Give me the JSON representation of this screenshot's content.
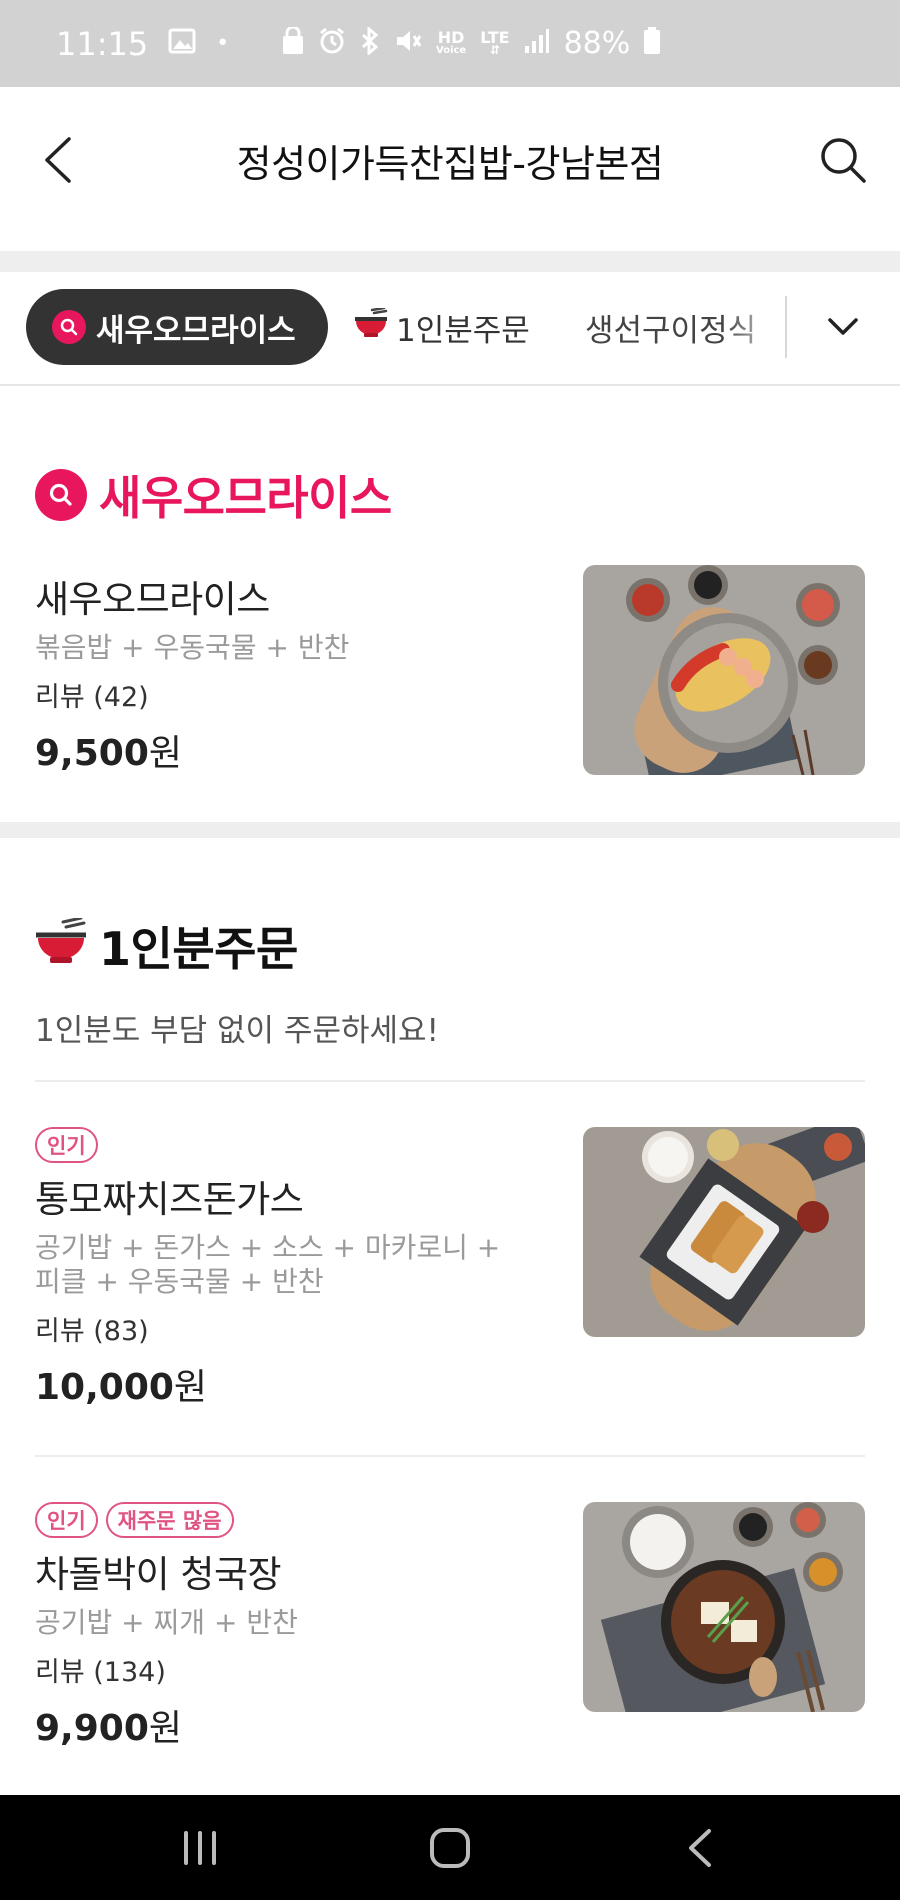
{
  "status_bar": {
    "time": "11:15",
    "dot": "•",
    "network_hd": "HD",
    "network_voice": "Voice",
    "network_lte": "LTE",
    "battery": "88%"
  },
  "header": {
    "title": "정성이가득찬집밥-강남본점",
    "back_icon": "chevron-left-icon",
    "search_icon": "search-icon"
  },
  "tabs": [
    {
      "label": "새우오므라이스",
      "icon": "search-icon",
      "active": true
    },
    {
      "label": "1인분주문",
      "icon": "bowl-icon",
      "active": false
    },
    {
      "label": "생선구이정식",
      "icon": "",
      "active": false
    }
  ],
  "sections": [
    {
      "title": "새우오므라이스",
      "icon": "search-icon",
      "items": [
        {
          "name": "새우오므라이스",
          "badges": [],
          "desc": "볶음밥 + 우동국물 + 반찬",
          "review": "리뷰 (42)",
          "price": "9,500",
          "currency": "원"
        }
      ]
    },
    {
      "title": "1인분주문",
      "icon": "bowl-icon",
      "subtitle": "1인분도 부담 없이 주문하세요!",
      "items": [
        {
          "name": "통모짜치즈돈가스",
          "badges": [
            "인기"
          ],
          "desc": "공기밥 + 돈가스 + 소스 + 마카로니 + 피클 + 우동국물 + 반찬",
          "review": "리뷰 (83)",
          "price": "10,000",
          "currency": "원"
        },
        {
          "name": "차돌박이 청국장",
          "badges": [
            "인기",
            "재주문 많음"
          ],
          "desc": "공기밥 + 찌개 + 반찬",
          "review": "리뷰 (134)",
          "price": "9,900",
          "currency": "원"
        }
      ]
    }
  ],
  "navbar": {
    "recent_icon": "recent-apps-icon",
    "home_icon": "home-icon",
    "back_icon": "back-icon"
  },
  "colors": {
    "accent": "#e8175d",
    "badge": "#e05485",
    "active_tab_bg": "#333333",
    "status_bar_bg": "#d2d2d2",
    "nav_bar_bg": "#000000"
  }
}
